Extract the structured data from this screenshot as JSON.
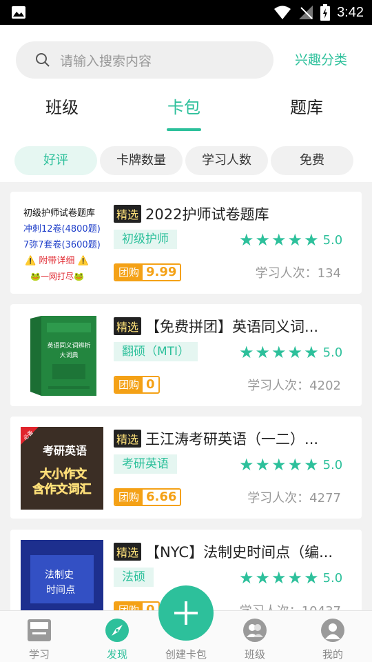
{
  "status_bar": {
    "time": "3:42"
  },
  "search": {
    "placeholder": "请输入搜索内容"
  },
  "interest_link": "兴趣分类",
  "tabs": [
    {
      "label": "班级",
      "active": false
    },
    {
      "label": "卡包",
      "active": true
    },
    {
      "label": "题库",
      "active": false
    }
  ],
  "filters": [
    {
      "label": "好评",
      "active": true
    },
    {
      "label": "卡牌数量",
      "active": false
    },
    {
      "label": "学习人数",
      "active": false
    },
    {
      "label": "免费",
      "active": false
    }
  ],
  "cards": [
    {
      "badge": "精选",
      "title": "2022护师试卷题库",
      "tag": "初级护师",
      "rating": "5.0",
      "group_label": "团购",
      "price": "9.99",
      "learners": "学习人次：134",
      "cover": {
        "lines": [
          "初级护师试卷题库",
          "冲刺12卷(4800题)",
          "7弥7套卷(3600题)",
          "⚠️ 附带详细 ⚠️",
          "🐸一网打尽🐸"
        ]
      }
    },
    {
      "badge": "精选",
      "title": "【免费拼团】英语同义词...",
      "tag": "翻硕（MTI）",
      "rating": "5.0",
      "group_label": "团购",
      "price": "0",
      "learners": "学习人次：4202",
      "cover": {
        "lines": [
          "英语同义词辨析",
          "大词典"
        ]
      }
    },
    {
      "badge": "精选",
      "title": "王江涛考研英语（一二）...",
      "tag": "考研英语",
      "rating": "5.0",
      "group_label": "团购",
      "price": "6.66",
      "learners": "学习人次：4277",
      "cover": {
        "corner": "必备",
        "lines": [
          "考研英语",
          "大小作文",
          "含作文词汇"
        ]
      }
    },
    {
      "badge": "精选",
      "title": "【NYC】法制史时间点（编...",
      "tag": "法硕",
      "rating": "5.0",
      "group_label": "团购",
      "price": "0",
      "learners": "学习人次：10437",
      "cover": {
        "lines": [
          "法制史",
          "时间点"
        ]
      }
    }
  ],
  "bottom_nav": [
    {
      "label": "学习",
      "icon": "book-icon",
      "active": false
    },
    {
      "label": "发现",
      "icon": "compass-icon",
      "active": true
    },
    {
      "label": "创建卡包",
      "icon": "plus-icon",
      "active": false
    },
    {
      "label": "班级",
      "icon": "group-icon",
      "active": false
    },
    {
      "label": "我的",
      "icon": "user-icon",
      "active": false
    }
  ],
  "colors": {
    "accent": "#2dc09b",
    "price": "#f4a116"
  }
}
